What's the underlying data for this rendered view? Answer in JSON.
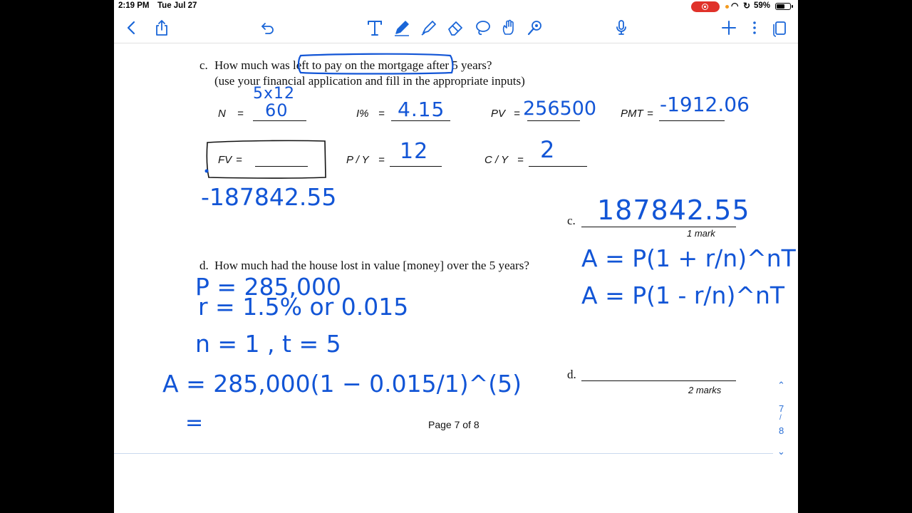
{
  "status": {
    "time": "2:19 PM",
    "date": "Tue Jul 27",
    "battery": "59%"
  },
  "toolbar": {
    "left": [
      "back-icon",
      "share-icon",
      "undo-icon"
    ],
    "center": [
      "text-tool-icon",
      "pen-icon",
      "highlighter-icon",
      "eraser-icon",
      "lasso-icon",
      "shape-hand-icon",
      "laser-pointer-icon"
    ],
    "right": [
      "microphone-icon",
      "add-icon",
      "more-icon",
      "pages-icon"
    ]
  },
  "question_c": {
    "label": "c.",
    "line1": "How much was left to pay on the mortgage after 5 years?",
    "line2": "(use your financial application and fill in the appropriate inputs)",
    "inputs": {
      "n": "N",
      "n_eq": "=",
      "i": "I%",
      "i_eq": "=",
      "pv": "PV",
      "pv_eq": "=",
      "pmt": "PMT",
      "pmt_eq": "=",
      "fv": "FV",
      "fv_eq": "=",
      "py": "P / Y",
      "py_eq": "=",
      "cy": "C / Y",
      "cy_eq": "="
    },
    "handwritten": {
      "n_note": "5x12",
      "n": "60",
      "i": "4.15",
      "pv": "256500",
      "pmt": "-1912.06",
      "py": "12",
      "cy": "2",
      "fv": "-187842.55"
    },
    "answer_label": "c.",
    "answer": "187842.55",
    "mark": "1 mark",
    "formula1": "A = P(1 + r/n)^nT",
    "formula2": "A = P(1 - r/n)^nT"
  },
  "question_d": {
    "label": "d.",
    "text": "How much had the house lost in value [money] over the 5 years?",
    "work": [
      "P = 285,000",
      "r = 1.5% or 0.015",
      "n = 1 ,  t = 5",
      "A = 285,000(1 − 0.015/1)^(5)",
      "="
    ],
    "answer_label": "d.",
    "mark": "2 marks"
  },
  "footer": {
    "page_text": "Page 7 of  8"
  },
  "page_nav": {
    "current": "7",
    "separator": "/",
    "total": "8"
  },
  "colors": {
    "ink": "#1255d6",
    "toolbar": "#1a66d8",
    "record": "#e0322a"
  }
}
